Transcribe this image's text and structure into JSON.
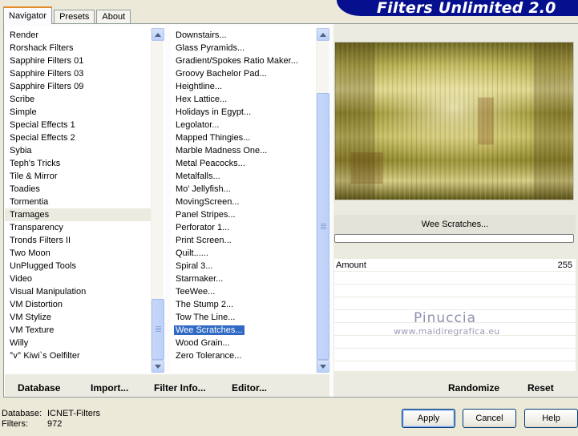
{
  "tabs": [
    "Navigator",
    "Presets",
    "About"
  ],
  "app_title": "Filters Unlimited 2.0",
  "categories": {
    "items": [
      "Render",
      "Rorshack Filters",
      "Sapphire Filters 01",
      "Sapphire Filters 03",
      "Sapphire Filters 09",
      "Scribe",
      "Simple",
      "Special Effects 1",
      "Special Effects 2",
      "Sybia",
      "Teph's Tricks",
      "Tile & Mirror",
      "Toadies",
      "Tormentia",
      "Tramages",
      "Transparency",
      "Tronds Filters II",
      "Two Moon",
      "UnPlugged Tools",
      "Video",
      "Visual Manipulation",
      "VM Distortion",
      "VM Stylize",
      "VM Texture",
      "Willy",
      "°v° Kiwi`s Oelfilter"
    ],
    "selected_index": 14
  },
  "filters": {
    "items": [
      "Downstairs...",
      "Glass Pyramids...",
      "Gradient/Spokes Ratio Maker...",
      "Groovy Bachelor Pad...",
      "Heightline...",
      "Hex Lattice...",
      "Holidays in Egypt...",
      "Legolator...",
      "Mapped Thingies...",
      "Marble Madness One...",
      "Metal Peacocks...",
      "Metalfalls...",
      "Mo' Jellyfish...",
      "MovingScreen...",
      "Panel Stripes...",
      "Perforator 1...",
      "Print Screen...",
      "Quilt......",
      "Spiral 3...",
      "Starmaker...",
      "TeeWee...",
      "The Stump 2...",
      "Tow The Line...",
      "Wee Scratches...",
      "Wood Grain...",
      "Zero Tolerance..."
    ],
    "selected_index": 23
  },
  "toolbar": {
    "database": "Database",
    "import": "Import...",
    "filter_info": "Filter Info...",
    "editor": "Editor...",
    "randomize": "Randomize",
    "reset": "Reset"
  },
  "current_filter": "Wee Scratches...",
  "params": [
    {
      "name": "Amount",
      "value": "255",
      "level": 1.0
    }
  ],
  "watermark": {
    "name": "Pinuccia",
    "url": "www.maidiregrafica.eu"
  },
  "status": {
    "database_label": "Database:",
    "database_value": "ICNET-Filters",
    "filters_label": "Filters:",
    "filters_value": "972"
  },
  "buttons": {
    "apply": "Apply",
    "cancel": "Cancel",
    "help": "Help"
  },
  "colors": {
    "banner": "#06108e",
    "selection": "#316ac5",
    "tab_accent": "#e68b2c"
  }
}
